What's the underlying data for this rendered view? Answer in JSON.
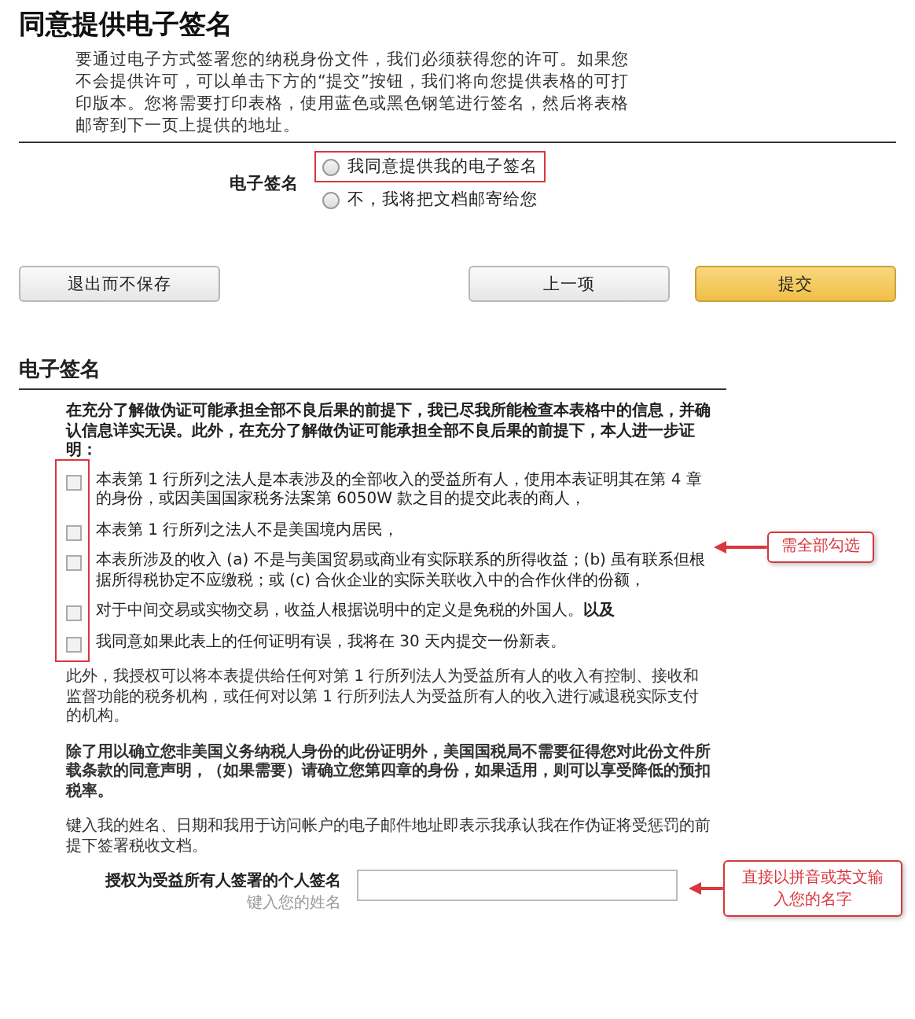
{
  "title": "同意提供电子签名",
  "intro": "要通过电子方式签署您的纳税身份文件，我们必须获得您的许可。如果您不会提供许可，可以单击下方的“提交”按钮，我们将向您提供表格的可打印版本。您将需要打印表格，使用蓝色或黑色钢笔进行签名，然后将表格邮寄到下一页上提供的地址。",
  "consent": {
    "label": "电子签名",
    "options": [
      {
        "label": "我同意提供我的电子签名",
        "selected": false,
        "highlighted": true
      },
      {
        "label": "不，我将把文档邮寄给您",
        "selected": false,
        "highlighted": false
      }
    ]
  },
  "buttons": [
    {
      "label": "退出而不保存",
      "kind": "default"
    },
    {
      "label": "上一项",
      "kind": "default"
    },
    {
      "label": "提交",
      "kind": "primary"
    }
  ],
  "signature_section": {
    "heading": "电子签名",
    "certification": "在充分了解做伪证可能承担全部不良后果的前提下，我已尽我所能检查本表格中的信息，并确认信息详实无误。此外，在充分了解做伪证可能承担全部不良后果的前提下，本人进一步证明：",
    "certifications": [
      {
        "text": "本表第 1 行所列之法人是本表涉及的全部收入的受益所有人，使用本表证明其在第 4 章的身份，或因美国国家税务法案第 6050W 款之目的提交此表的商人，",
        "checked": false
      },
      {
        "text": "本表第 1 行所列之法人不是美国境内居民，",
        "checked": false
      },
      {
        "text": "本表所涉及的收入 (a) 不是与美国贸易或商业有实际联系的所得收益；(b) 虽有联系但根据所得税协定不应缴税；或 (c) 合伙企业的实际关联收入中的合作伙伴的份额，",
        "checked": false
      },
      {
        "text": "对于中间交易或实物交易，收益人根据说明中的定义是免税的外国人。**以及**",
        "checked": false
      },
      {
        "text": "我同意如果此表上的任何证明有误，我将在 30 天内提交一份新表。",
        "checked": false
      }
    ],
    "certifications_note": {
      "text": "需全部勾选"
    },
    "authorization": "此外，我授权可以将本表提供给任何对第 1 行所列法人为受益所有人的收入有控制、接收和监督功能的税务机构，或任何对以第 1 行所列法人为受益所有人的收入进行减退税实际支付的机构。",
    "notice": "除了用以确立您非美国义务纳税人身份的此份证明外，美国国税局不需要征得您对此份文件所载条款的同意声明，（如果需要）请确立您第四章的身份，如果适用，则可以享受降低的预扣税率。",
    "agreement": "键入我的姓名、日期和我用于访问帐户的电子邮件地址即表示我承认我在作伪证将受惩罚的前提下签署税收文档。",
    "signature_field": {
      "label": "授权为受益所有人签署的个人签名",
      "hint": "键入您的姓名",
      "note": {
        "text": "直接以拼音或英文输入您的名字"
      }
    }
  }
}
